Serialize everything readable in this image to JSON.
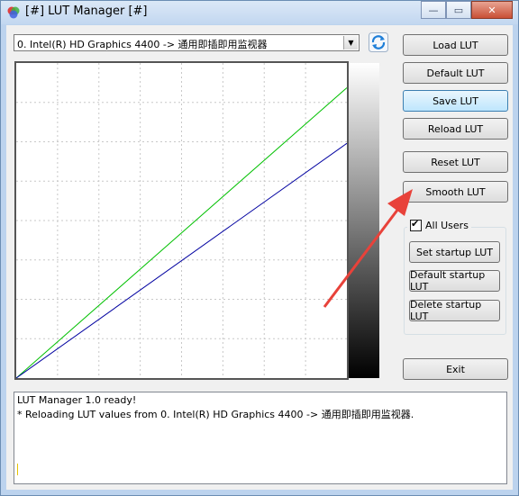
{
  "window": {
    "title": "[#] LUT Manager [#]"
  },
  "titlebar_buttons": {
    "minimize": "—",
    "maximize": "▭",
    "close": "✕"
  },
  "display_select": {
    "value": "0. Intel(R) HD Graphics 4400 -> 通用即插即用监视器"
  },
  "buttons": {
    "load": "Load LUT",
    "default": "Default LUT",
    "save": "Save LUT",
    "reload": "Reload LUT",
    "reset": "Reset LUT",
    "smooth": "Smooth LUT",
    "exit": "Exit"
  },
  "group": {
    "all_users_label": "All Users",
    "all_users_checked": true,
    "set_startup": "Set startup LUT",
    "default_startup": "Default startup LUT",
    "delete_startup": "Delete startup LUT"
  },
  "log": {
    "lines": [
      "LUT Manager 1.0 ready!",
      "* Reloading LUT values from 0. Intel(R) HD Graphics 4400 -> 通用即插即用监视器."
    ]
  },
  "chart_data": {
    "type": "line",
    "x": [
      0,
      255
    ],
    "series": [
      {
        "values": [
          0,
          235
        ],
        "color": "#00c000"
      },
      {
        "values": [
          0,
          190
        ],
        "color": "#0000a0"
      }
    ],
    "xlim": [
      0,
      255
    ],
    "ylim": [
      0,
      255
    ],
    "grid": true
  },
  "colors": {
    "accent": "#3c7fb1",
    "annotation_arrow": "#e8423a"
  }
}
